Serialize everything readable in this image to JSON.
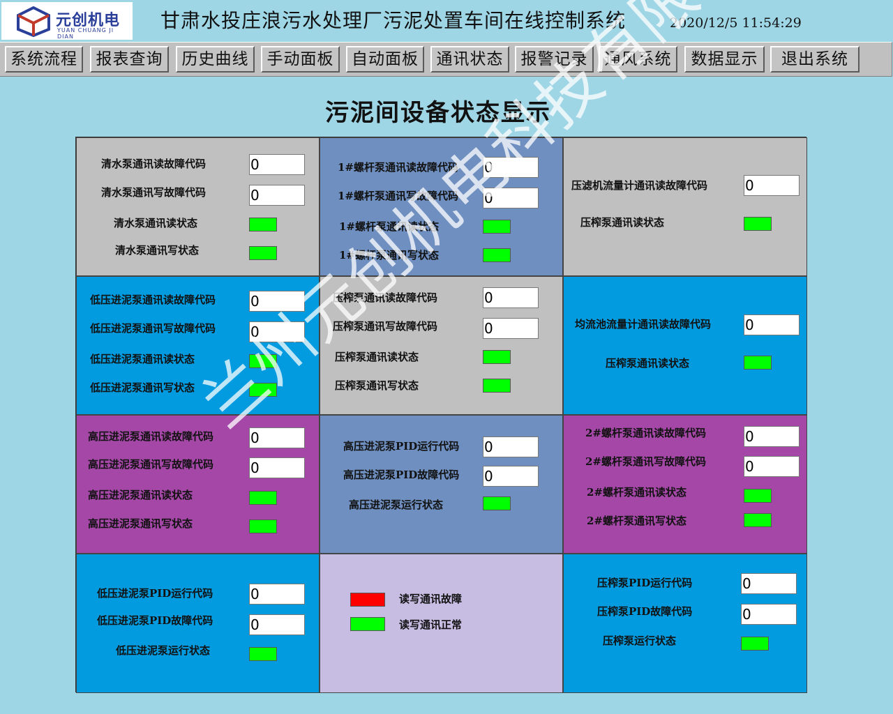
{
  "header": {
    "logo_name": "元创机电",
    "logo_pinyin": "YUAN CHUANG JI DIAN",
    "title": "甘肃水投庄浪污水处理厂污泥处置车间在线控制系统",
    "datetime": "2020/12/5 11:54:29"
  },
  "nav": [
    "系统流程",
    "报表查询",
    "历史曲线",
    "手动面板",
    "自动面板",
    "通讯状态",
    "报警记录",
    "通风系统",
    "数据显示",
    "退出系统"
  ],
  "page_title": "污泥间设备状态显示",
  "colors": {
    "gray": "#c0c0c0",
    "steel": "#6e8fbf",
    "cyan": "#039be0",
    "purple": "#a447a7",
    "lavender": "#c7bde3",
    "ok": "#00ff00",
    "err": "#ff0000"
  },
  "panels": [
    {
      "id": "p1",
      "rows": [
        {
          "label": "清水泵通讯读故障代码",
          "value": "0"
        },
        {
          "label": "清水泵通讯写故障代码",
          "value": "0"
        },
        {
          "label": "清水泵通讯读状态",
          "status": "ok"
        },
        {
          "label": "清水泵通讯写状态",
          "status": "ok"
        }
      ]
    },
    {
      "id": "p2",
      "rows": [
        {
          "label": "1#螺杆泵通讯读故障代码",
          "value": "0"
        },
        {
          "label": "1#螺杆泵通讯写故障代码",
          "value": "0"
        },
        {
          "label": "1#螺杆泵通讯读状态",
          "status": "ok"
        },
        {
          "label": "1#螺杆泵通讯写状态",
          "status": "ok"
        }
      ]
    },
    {
      "id": "p3",
      "rows": [
        {
          "label": "压滤机流量计通讯读故障代码",
          "value": "0"
        },
        {
          "label": "压榨泵通讯读状态",
          "status": "ok"
        }
      ]
    },
    {
      "id": "p4",
      "rows": [
        {
          "label": "低压进泥泵通讯读故障代码",
          "value": "0"
        },
        {
          "label": "低压进泥泵通讯写故障代码",
          "value": "0"
        },
        {
          "label": "低压进泥泵通讯读状态",
          "status": "ok"
        },
        {
          "label": "低压进泥泵通讯写状态",
          "status": "ok"
        }
      ]
    },
    {
      "id": "p5",
      "rows": [
        {
          "label": "压榨泵通讯读故障代码",
          "value": "0"
        },
        {
          "label": "压榨泵通讯写故障代码",
          "value": "0"
        },
        {
          "label": "压榨泵通讯读状态",
          "status": "ok"
        },
        {
          "label": "压榨泵通讯写状态",
          "status": "ok"
        }
      ]
    },
    {
      "id": "p6",
      "rows": [
        {
          "label": "均流池流量计通讯读故障代码",
          "value": "0"
        },
        {
          "label": "压榨泵通讯读状态",
          "status": "ok"
        }
      ]
    },
    {
      "id": "p7",
      "rows": [
        {
          "label": "高压进泥泵通讯读故障代码",
          "value": "0"
        },
        {
          "label": "高压进泥泵通讯写故障代码",
          "value": "0"
        },
        {
          "label": "高压进泥泵通讯读状态",
          "status": "ok"
        },
        {
          "label": "高压进泥泵通讯写状态",
          "status": "ok"
        }
      ]
    },
    {
      "id": "p8",
      "rows": [
        {
          "label": "高压进泥泵PID运行代码",
          "value": "0"
        },
        {
          "label": "高压进泥泵PID故障代码",
          "value": "0"
        },
        {
          "label": "高压进泥泵运行状态",
          "status": "ok"
        }
      ]
    },
    {
      "id": "p9",
      "rows": [
        {
          "label": "2#螺杆泵通讯读故障代码",
          "value": "0"
        },
        {
          "label": "2#螺杆泵通讯写故障代码",
          "value": "0"
        },
        {
          "label": "2#螺杆泵通讯读状态",
          "status": "ok"
        },
        {
          "label": "2#螺杆泵通讯写状态",
          "status": "ok"
        }
      ]
    },
    {
      "id": "p10",
      "rows": [
        {
          "label": "低压进泥泵PID运行代码",
          "value": "0"
        },
        {
          "label": "低压进泥泵PID故障代码",
          "value": "0"
        },
        {
          "label": "低压进泥泵运行状态",
          "status": "ok"
        }
      ]
    },
    {
      "id": "p12",
      "rows": [
        {
          "label": "压榨泵PID运行代码",
          "value": "0"
        },
        {
          "label": "压榨泵PID故障代码",
          "value": "0"
        },
        {
          "label": "压榨泵运行状态",
          "status": "ok"
        }
      ]
    }
  ],
  "legend": {
    "error_label": "读写通讯故障",
    "normal_label": "读写通讯正常"
  },
  "watermark": "兰州元创机电科技有限公司"
}
